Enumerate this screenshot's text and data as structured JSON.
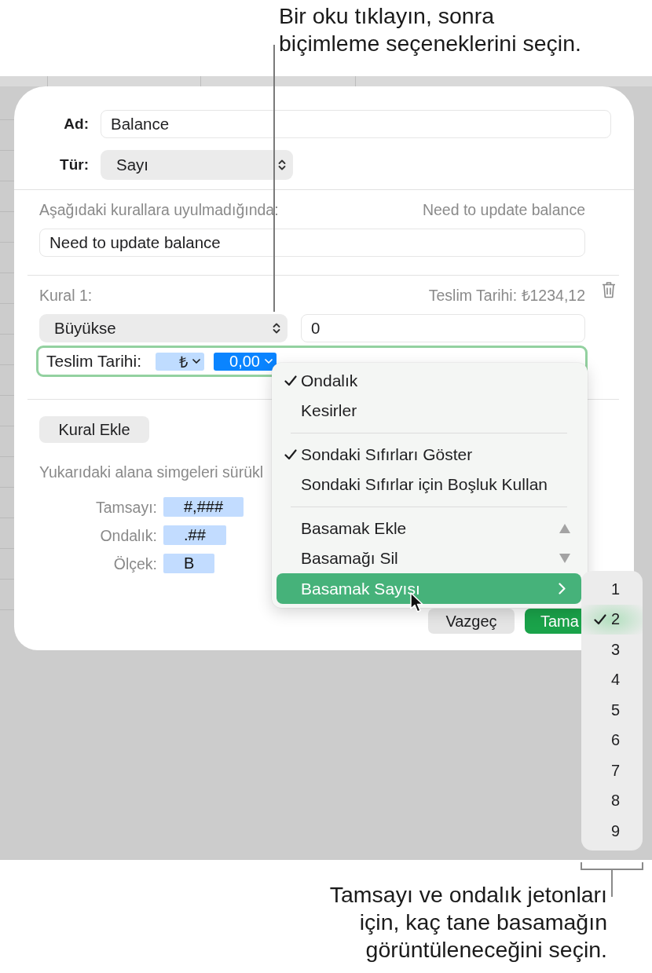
{
  "top_callout": {
    "text": "Bir oku tıklayın, sonra\nbiçimleme seçeneklerini seçin."
  },
  "dialog": {
    "name": {
      "label": "Ad:",
      "value": "Balance"
    },
    "type": {
      "label": "Tür:",
      "value": "Sayı"
    },
    "invalid": {
      "label": "Aşağıdaki kurallara uyulmadığında:",
      "preview": "Need to update balance",
      "value": "Need to update balance"
    },
    "rules": [
      {
        "label": "Kural 1:",
        "preview": "Teslim Tarihi: ₺1234,12",
        "condition": "Büyükse",
        "value": "0",
        "format_label": "Teslim Tarihi:",
        "tokens": [
          {
            "text": "₺",
            "selected": false
          },
          {
            "text": "0,00",
            "selected": true
          }
        ]
      }
    ],
    "add_rule": "Kural Ekle",
    "hint": "Yukarıdaki alana simgeleri sürükl",
    "token_rows": [
      {
        "label": "Tamsayı:",
        "token": "#,###"
      },
      {
        "label": "Ondalık:",
        "token": ".##"
      },
      {
        "label": "Ölçek:",
        "token": "B"
      }
    ],
    "buttons": [
      {
        "label": "Vazgeç",
        "kind": "secondary"
      },
      {
        "label": "Tama",
        "kind": "primary"
      }
    ]
  },
  "menu": {
    "items": [
      {
        "kind": "item",
        "label": "Ondalık",
        "checked": true,
        "selected": false
      },
      {
        "kind": "item",
        "label": "Kesirler",
        "checked": false,
        "selected": false
      },
      {
        "kind": "separator"
      },
      {
        "kind": "item",
        "label": "Sondaki Sıfırları Göster",
        "checked": true,
        "selected": false
      },
      {
        "kind": "item",
        "label": "Sondaki Sıfırlar için Boşluk Kullan",
        "checked": false,
        "selected": false
      },
      {
        "kind": "separator"
      },
      {
        "kind": "increase",
        "label": "Basamak Ekle",
        "checked": false,
        "selected": false
      },
      {
        "kind": "decrease",
        "label": "Basamağı Sil",
        "checked": false,
        "selected": false
      },
      {
        "kind": "submenu",
        "label": "Basamak Sayısı",
        "checked": false,
        "selected": true
      }
    ]
  },
  "submenu": {
    "items": [
      {
        "label": "1",
        "checked": false,
        "highlighted": false
      },
      {
        "label": "2",
        "checked": true,
        "highlighted": true
      },
      {
        "label": "3",
        "checked": false,
        "highlighted": false
      },
      {
        "label": "4",
        "checked": false,
        "highlighted": false
      },
      {
        "label": "5",
        "checked": false,
        "highlighted": false
      },
      {
        "label": "6",
        "checked": false,
        "highlighted": false
      },
      {
        "label": "7",
        "checked": false,
        "highlighted": false
      },
      {
        "label": "8",
        "checked": false,
        "highlighted": false
      },
      {
        "label": "9",
        "checked": false,
        "highlighted": false
      }
    ]
  },
  "bottom_callout": {
    "text": "Tamsayı ve ondalık jetonları\niçin, kaç tane basamağın\ngörüntüleneceğini seçin."
  }
}
